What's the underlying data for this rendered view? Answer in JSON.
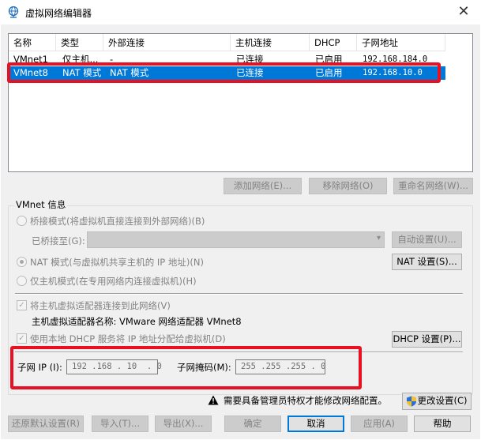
{
  "window": {
    "title": "虚拟网络编辑器",
    "close_glyph": "✕"
  },
  "table": {
    "headers": [
      "名称",
      "类型",
      "外部连接",
      "主机连接",
      "DHCP",
      "子网地址"
    ],
    "rows": [
      {
        "name": "VMnet1",
        "type": "仅主机...",
        "external": "-",
        "host": "已连接",
        "dhcp": "已启用",
        "subnet": "192.168.184.0",
        "selected": false
      },
      {
        "name": "VMnet8",
        "type": "NAT 模式",
        "external": "NAT 模式",
        "host": "已连接",
        "dhcp": "已启用",
        "subnet": "192.168.10.0",
        "selected": true
      }
    ]
  },
  "list_buttons": {
    "add": "添加网络(E)...",
    "remove": "移除网络(O)",
    "rename": "重命名网络(W)..."
  },
  "vmnet_info": {
    "group_label": "VMnet 信息",
    "bridge_mode": "桥接模式(将虚拟机直接连接到外部网络)(B)",
    "bridged_to_label": "已桥接至(G):",
    "auto_settings": "自动设置(U)...",
    "nat_mode": "NAT 模式(与虚拟机共享主机的 IP 地址)(N)",
    "nat_settings": "NAT 设置(S)...",
    "host_only_mode": "仅主机模式(在专用网络内连接虚拟机)(H)",
    "connect_adapter": "将主机虚拟适配器连接到此网络(V)",
    "adapter_name": "主机虚拟适配器名称: VMware 网络适配器 VMnet8",
    "use_dhcp": "使用本地 DHCP 服务将 IP 地址分配给虚拟机(D)",
    "dhcp_settings": "DHCP 设置(P)...",
    "subnet_ip_label": "子网 IP (I):",
    "subnet_ip": "192 .168 . 10  . 0",
    "subnet_mask_label": "子网掩码(M):",
    "subnet_mask": "255 .255 .255 . 0"
  },
  "admin_notice": "需要具备管理员特权才能修改网络配置。",
  "change_settings": "更改设置(C)",
  "bottom_buttons": {
    "restore": "还原默认设置(R)",
    "import": "导入(T)...",
    "export": "导出(X)...",
    "ok": "确定",
    "cancel": "取消",
    "apply": "应用(A)",
    "help": "帮助"
  },
  "colors": {
    "selection": "#0078d7",
    "highlight_box": "#e81123"
  },
  "icons": {
    "app": "network-globe-icon",
    "warning": "warning-icon",
    "shield": "uac-shield-icon"
  }
}
